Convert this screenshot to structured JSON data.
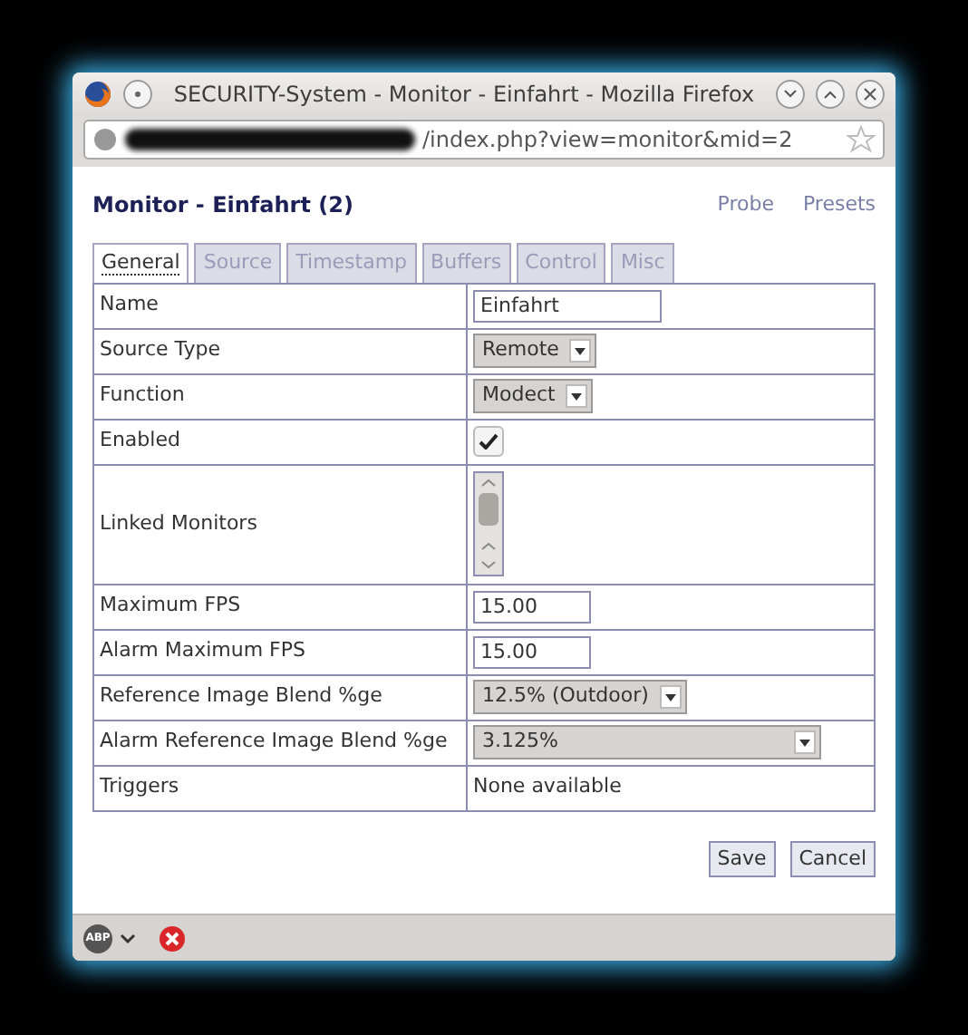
{
  "window": {
    "title": "SECURITY-System - Monitor - Einfahrt - Mozilla Firefox"
  },
  "address_bar": {
    "url_visible": "/index.php?view=monitor&mid=2"
  },
  "page": {
    "heading": "Monitor - Einfahrt (2)",
    "links": [
      "Probe",
      "Presets"
    ]
  },
  "tabs": [
    {
      "label": "General",
      "selected": true
    },
    {
      "label": "Source",
      "selected": false
    },
    {
      "label": "Timestamp",
      "selected": false
    },
    {
      "label": "Buffers",
      "selected": false
    },
    {
      "label": "Control",
      "selected": false
    },
    {
      "label": "Misc",
      "selected": false
    }
  ],
  "form_rows": [
    {
      "label": "Name",
      "kind": "input",
      "value": "Einfahrt"
    },
    {
      "label": "Source Type",
      "kind": "select",
      "value": "Remote"
    },
    {
      "label": "Function",
      "kind": "select",
      "value": "Modect"
    },
    {
      "label": "Enabled",
      "kind": "checkbox",
      "checked": true
    },
    {
      "label": "Linked Monitors",
      "kind": "listbox"
    },
    {
      "label": "Maximum FPS",
      "kind": "input",
      "value": "15.00"
    },
    {
      "label": "Alarm Maximum FPS",
      "kind": "input",
      "value": "15.00"
    },
    {
      "label": "Reference Image Blend %ge",
      "kind": "select",
      "value": "12.5% (Outdoor)"
    },
    {
      "label": "Alarm Reference Image Blend %ge",
      "kind": "select",
      "value": "3.125%"
    },
    {
      "label": "Triggers",
      "kind": "text",
      "value": "None available"
    }
  ],
  "buttons": [
    "Save",
    "Cancel"
  ],
  "status_bar": {
    "addon_label": "ABP"
  }
}
